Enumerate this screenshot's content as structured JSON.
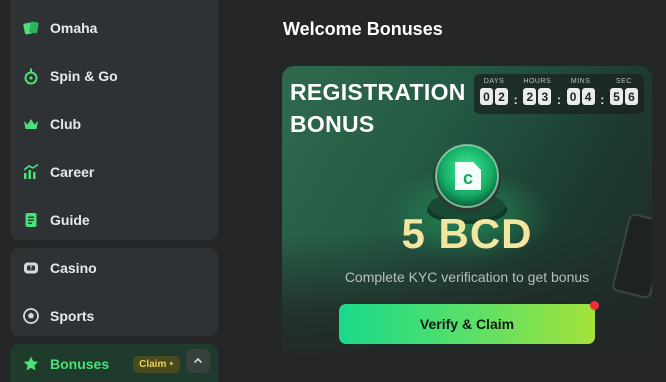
{
  "sidebar": {
    "items": [
      {
        "label": "Omaha",
        "icon": "omaha-cards-icon"
      },
      {
        "label": "Spin & Go",
        "icon": "spin-go-icon"
      },
      {
        "label": "Club",
        "icon": "crown-icon"
      },
      {
        "label": "Career",
        "icon": "career-chart-icon"
      },
      {
        "label": "Guide",
        "icon": "guide-book-icon"
      },
      {
        "label": "Casino",
        "icon": "slot-machine-icon"
      },
      {
        "label": "Sports",
        "icon": "soccer-ball-icon"
      },
      {
        "label": "Bonuses",
        "icon": "star-icon",
        "badge": "Claim",
        "active": true
      }
    ]
  },
  "main": {
    "section_title": "Welcome Bonuses"
  },
  "promo": {
    "title_line1": "REGISTRATION",
    "title_line2": "BONUS",
    "countdown": {
      "days_label": "DAYS",
      "hours_label": "HOURS",
      "mins_label": "MINS",
      "sec_label": "SEC",
      "days": [
        "0",
        "2"
      ],
      "hours": [
        "2",
        "3"
      ],
      "mins": [
        "0",
        "4"
      ],
      "sec": [
        "5",
        "6"
      ]
    },
    "amount": "5 BCD",
    "subtitle": "Complete KYC verification to get bonus",
    "button_label": "Verify & Claim"
  },
  "colors": {
    "accent_green": "#4be07a",
    "gold": "#f4e6a0",
    "notification_red": "#ec2f3b"
  }
}
